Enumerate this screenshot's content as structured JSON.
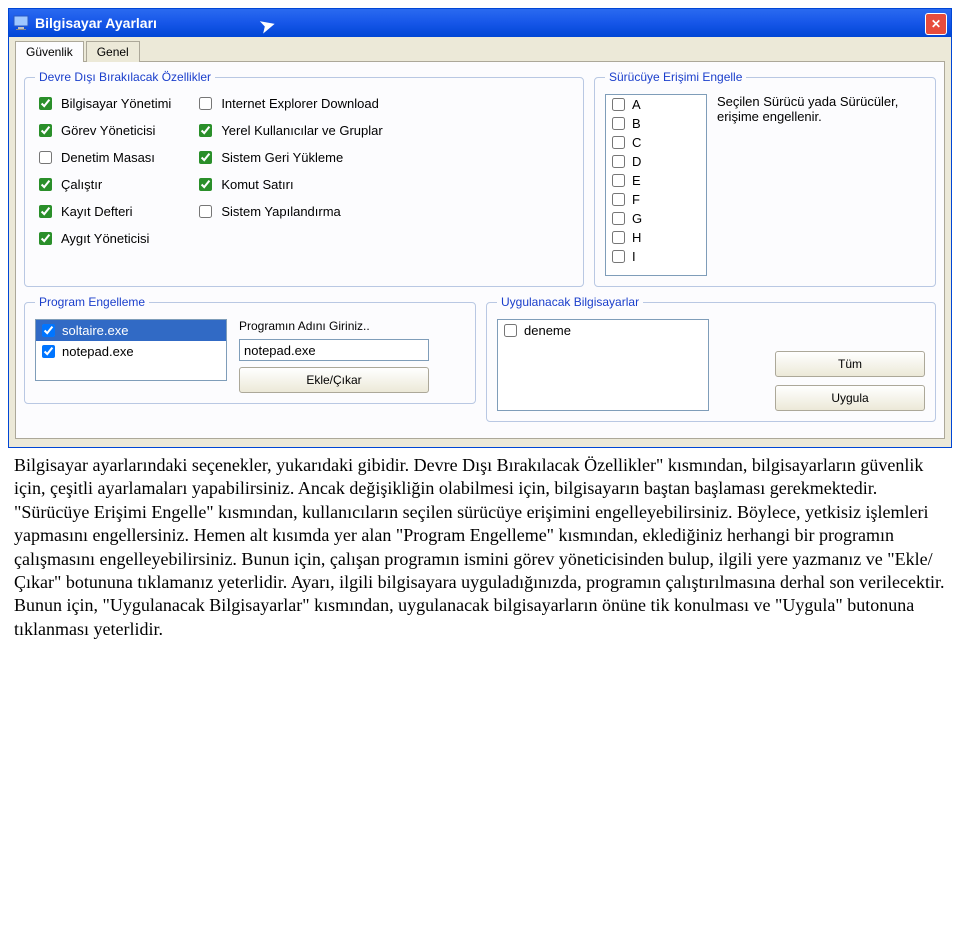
{
  "window": {
    "title": "Bilgisayar Ayarları"
  },
  "tabs": {
    "security": "Güvenlik",
    "general": "Genel"
  },
  "features": {
    "legend": "Devre Dışı Bırakılacak Özellikler",
    "col1": [
      {
        "label": "Bilgisayar Yönetimi",
        "checked": true
      },
      {
        "label": "Görev Yöneticisi",
        "checked": true
      },
      {
        "label": "Denetim Masası",
        "checked": false
      },
      {
        "label": "Çalıştır",
        "checked": true
      },
      {
        "label": "Kayıt Defteri",
        "checked": true
      },
      {
        "label": "Aygıt Yöneticisi",
        "checked": true
      }
    ],
    "col2": [
      {
        "label": "Internet Explorer Download",
        "checked": false
      },
      {
        "label": "Yerel Kullanıcılar ve Gruplar",
        "checked": true
      },
      {
        "label": "Sistem Geri Yükleme",
        "checked": true
      },
      {
        "label": "Komut Satırı",
        "checked": true
      },
      {
        "label": "Sistem Yapılandırma",
        "checked": false
      }
    ]
  },
  "drives": {
    "legend": "Sürücüye Erişimi Engelle",
    "letters": [
      "A",
      "B",
      "C",
      "D",
      "E",
      "F",
      "G",
      "H",
      "I"
    ],
    "desc": "Seçilen Sürücü yada Sürücüler, erişime engellenir."
  },
  "programs": {
    "legend": "Program Engelleme",
    "items": [
      {
        "label": "soltaire.exe",
        "checked": true,
        "selected": true
      },
      {
        "label": "notepad.exe",
        "checked": true,
        "selected": false
      }
    ],
    "input_label": "Programın Adını Giriniz..",
    "input_value": "notepad.exe",
    "button": "Ekle/Çıkar"
  },
  "apply": {
    "legend": "Uygulanacak Bilgisayarlar",
    "items": [
      {
        "label": "deneme",
        "checked": false
      }
    ],
    "btn_all": "Tüm",
    "btn_apply": "Uygula"
  },
  "explain": "Bilgisayar ayarlarındaki seçenekler, yukarıdaki gibidir. Devre Dışı Bırakılacak Özellikler\" kısmından, bilgisayarların güvenlik için, çeşitli ayarlamaları yapabilirsiniz. Ancak değişikliğin olabilmesi için, bilgisayarın baştan başlaması gerekmektedir. \"Sürücüye Erişimi Engelle\" kısmından, kullanıcıların seçilen sürücüye erişimini engelleyebilirsiniz. Böylece, yetkisiz işlemleri yapmasını engellersiniz. Hemen alt kısımda yer alan \"Program Engelleme\" kısmından, eklediğiniz herhangi bir programın çalışmasını engelleyebilirsiniz. Bunun için, çalışan programın ismini görev yöneticisinden bulup, ilgili yere yazmanız ve \"Ekle/Çıkar\" botununa tıklamanız yeterlidir. Ayarı, ilgili bilgisayara uyguladığınızda, programın çalıştırılmasına derhal son verilecektir. Bunun için, \"Uygulanacak Bilgisayarlar\" kısmından, uygulanacak bilgisayarların önüne tik konulması ve \"Uygula\" butonuna tıklanması yeterlidir."
}
